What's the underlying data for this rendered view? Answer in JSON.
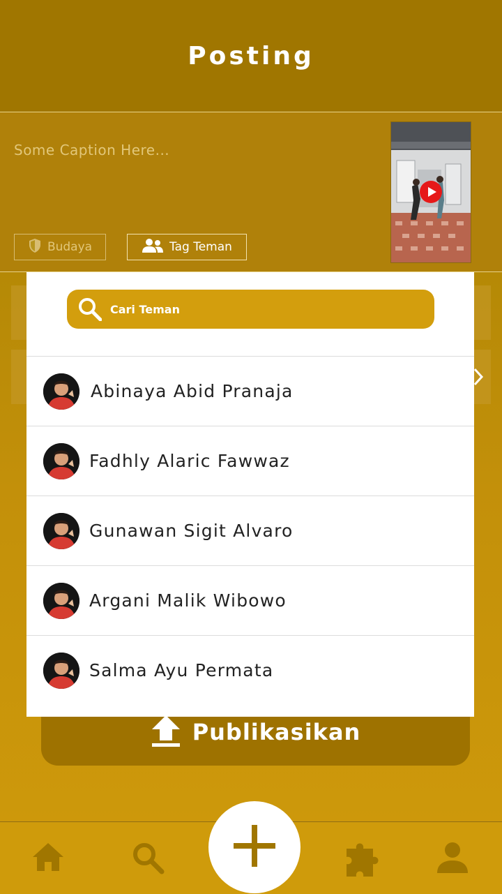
{
  "header": {
    "title": "Posting"
  },
  "compose": {
    "caption_placeholder": "Some Caption Here...",
    "category_label": "Budaya",
    "tag_label": "Tag Teman",
    "category_icon": "shield-icon",
    "tag_icon": "people-icon",
    "thumbnail_icon": "play-icon"
  },
  "tag_dropdown": {
    "search_placeholder": "Cari Teman",
    "friends": [
      {
        "name": "Abinaya Abid Pranaja"
      },
      {
        "name": "Fadhly Alaric Fawwaz"
      },
      {
        "name": "Gunawan Sigit Alvaro"
      },
      {
        "name": "Argani Malik Wibowo"
      },
      {
        "name": "Salma Ayu Permata"
      }
    ]
  },
  "publish": {
    "label": "Publikasikan",
    "icon": "upload-icon"
  },
  "bottom_nav": {
    "items": [
      {
        "icon": "home-icon"
      },
      {
        "icon": "search-icon"
      },
      {
        "icon": "plus-icon"
      },
      {
        "icon": "puzzle-icon"
      },
      {
        "icon": "profile-icon"
      }
    ]
  },
  "colors": {
    "primary": "#a07600",
    "accent": "#d39e0d",
    "surface": "#ffffff"
  }
}
